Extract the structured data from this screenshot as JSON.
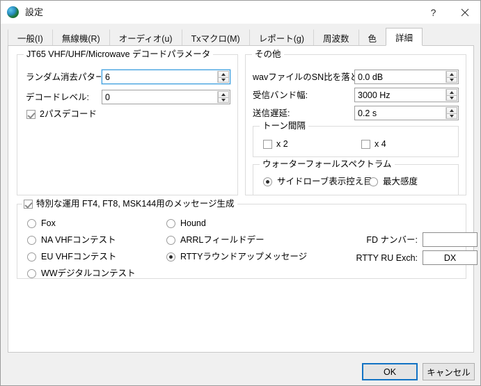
{
  "window": {
    "title": "設定",
    "icon": "globe-icon",
    "help_label": "?",
    "close_label": "✕"
  },
  "tabs": [
    {
      "label": "一般(I)",
      "selected": false
    },
    {
      "label": "無線機(R)",
      "selected": false
    },
    {
      "label": "オーディオ(u)",
      "selected": false
    },
    {
      "label": "Txマクロ(M)",
      "selected": false
    },
    {
      "label": "レポート(g)",
      "selected": false
    },
    {
      "label": "周波数",
      "selected": false
    },
    {
      "label": "色",
      "selected": false
    },
    {
      "label": "詳細",
      "selected": true
    }
  ],
  "jt65_group": {
    "legend": "JT65 VHF/UHF/Microwave デコードパラメータ",
    "random_erasure_label": "ランダム消去パターン:",
    "random_erasure_value": "6",
    "decode_level_label": "デコードレベル:",
    "decode_level_value": "0",
    "two_pass_label": "2パスデコード",
    "two_pass_checked": true
  },
  "other_group": {
    "legend": "その他",
    "wav_snr_label": "wavファイルのSN比を落とす:",
    "wav_snr_value": "0.0 dB",
    "rx_bandwidth_label": "受信バンド幅:",
    "rx_bandwidth_value": "3000  Hz",
    "tx_delay_label": "送信遅延:",
    "tx_delay_value": "0.2  s",
    "tone_group": {
      "legend": "トーン間隔",
      "x2_label": "x 2",
      "x2_checked": false,
      "x4_label": "x 4",
      "x4_checked": false
    },
    "waterfall_group": {
      "legend": "ウォーターフォールスペクトラム",
      "low_sidelobe_label": "サイドローブ表示控え目",
      "low_sidelobe_selected": true,
      "max_sensitivity_label": "最大感度",
      "max_sensitivity_selected": false
    }
  },
  "special_group": {
    "legend": "特別な運用  FT4, FT8, MSK144用のメッセージ生成",
    "legend_checked": true,
    "left_options": [
      {
        "label": "Fox",
        "selected": false
      },
      {
        "label": "NA VHFコンテスト",
        "selected": false
      },
      {
        "label": "EU VHFコンテスト",
        "selected": false
      },
      {
        "label": "WWデジタルコンテスト",
        "selected": false
      }
    ],
    "right_options": [
      {
        "label": "Hound",
        "selected": false
      },
      {
        "label": "ARRLフィールドデー",
        "selected": false
      },
      {
        "label": "RTTYラウンドアップメッセージ",
        "selected": true
      }
    ],
    "fd_number_label": "FD ナンバー:",
    "fd_number_value": "",
    "rtty_ru_label": "RTTY RU Exch:",
    "rtty_ru_value": "DX"
  },
  "footer": {
    "ok_label": "OK",
    "cancel_label": "キャンセル"
  },
  "colors": {
    "accent": "#1273c4",
    "focus_border": "#3399dd",
    "window_bg": "#f0f0f0",
    "page_bg": "#ffffff"
  }
}
